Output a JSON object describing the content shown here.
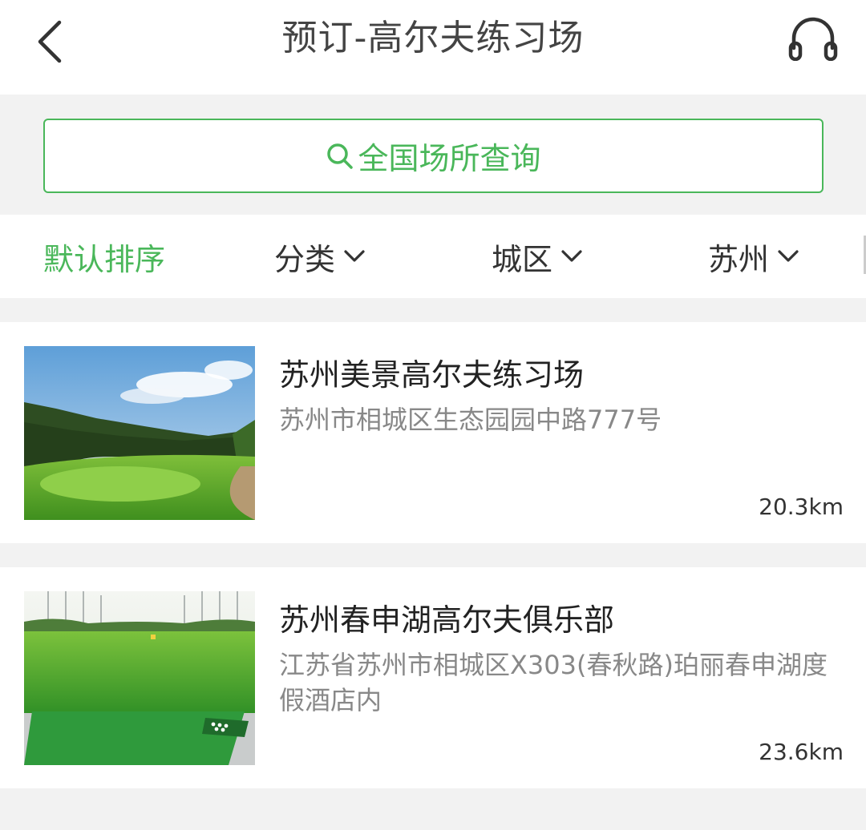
{
  "header": {
    "title": "预订-高尔夫练习场",
    "back_icon": "chevron-left-icon",
    "support_icon": "headset-icon"
  },
  "search": {
    "label": "全国场所查询",
    "icon": "search-icon"
  },
  "filters": [
    {
      "label": "默认排序",
      "active": true
    },
    {
      "label": "分类",
      "active": false
    },
    {
      "label": "城区",
      "active": false
    },
    {
      "label": "苏州",
      "active": false
    }
  ],
  "venues": [
    {
      "name": "苏州美景高尔夫练习场",
      "address": "苏州市相城区生态园园中路777号",
      "distance": "20.3km"
    },
    {
      "name": "苏州春申湖高尔夫俱乐部",
      "address": "江苏省苏州市相城区X303(春秋路)珀丽春申湖度假酒店内",
      "distance": "23.6km"
    }
  ],
  "colors": {
    "accent": "#4ab75a",
    "background": "#f2f2f2",
    "title_text": "#444444",
    "secondary_text": "#888888"
  }
}
